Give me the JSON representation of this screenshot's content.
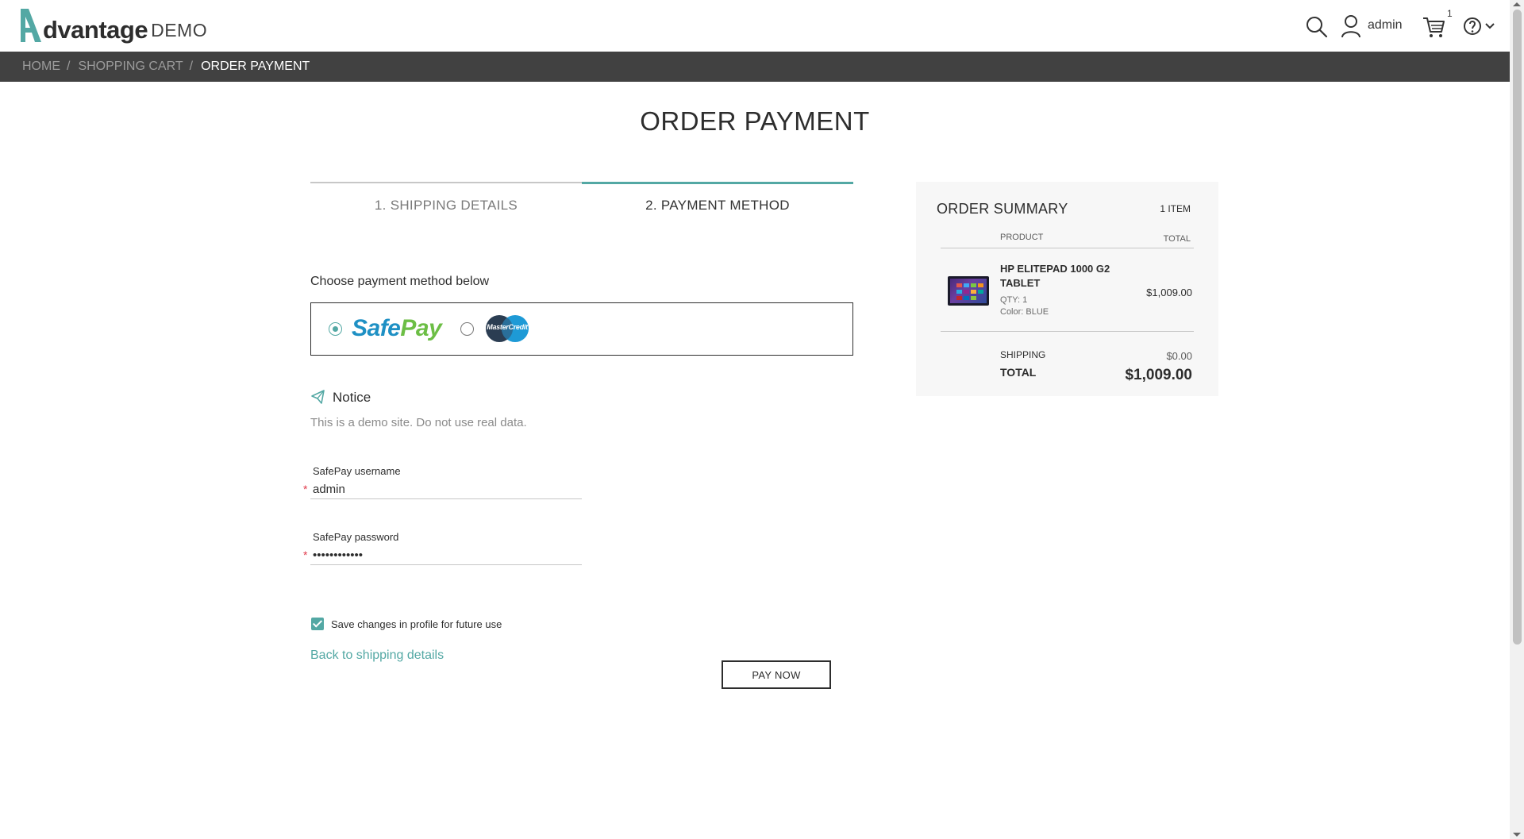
{
  "header": {
    "logo_word": "dvantage",
    "logo_suffix": "DEMO",
    "username": "admin",
    "cart_count": "1",
    "icons": [
      "search-icon",
      "user-icon",
      "cart-icon",
      "help-icon"
    ]
  },
  "breadcrumb": {
    "items": [
      "HOME",
      "SHOPPING CART",
      "ORDER PAYMENT"
    ],
    "separator": "/"
  },
  "page": {
    "title": "ORDER PAYMENT"
  },
  "steps": [
    {
      "label": "1. SHIPPING DETAILS",
      "active": false
    },
    {
      "label": "2. PAYMENT METHOD",
      "active": true
    }
  ],
  "payment": {
    "choose_label": "Choose payment method below",
    "methods": [
      {
        "name": "SafePay",
        "logo_part1": "Safe",
        "logo_part2": "Pay",
        "selected": true
      },
      {
        "name": "MasterCredit",
        "logo_text": "MasterCredit",
        "selected": false
      }
    ]
  },
  "notice": {
    "title": "Notice",
    "text": "This is a demo site. Do not use real data."
  },
  "fields": {
    "username": {
      "label": "SafePay username",
      "value": "admin",
      "required_mark": "*"
    },
    "password": {
      "label": "SafePay password",
      "value": "••••••••••••",
      "required_mark": "*"
    }
  },
  "save": {
    "label": "Save changes in profile for future use",
    "checked": true
  },
  "actions": {
    "back_link": "Back to shipping details",
    "pay_now": "PAY NOW"
  },
  "summary": {
    "title": "ORDER SUMMARY",
    "item_count": "1 ITEM",
    "col_product": "PRODUCT",
    "col_total": "TOTAL",
    "product": {
      "name": "HP ELITEPAD 1000 G2 TABLET",
      "qty": "QTY: 1",
      "color": "Color: BLUE",
      "price": "$1,009.00"
    },
    "shipping_label": "SHIPPING",
    "shipping_value": "$0.00",
    "total_label": "TOTAL",
    "total_value": "$1,009.00"
  },
  "colors": {
    "accent": "#53a8a4",
    "breadcrumb_bg": "#414141",
    "summary_bg": "#f7f7f7",
    "required": "#e0394a"
  }
}
